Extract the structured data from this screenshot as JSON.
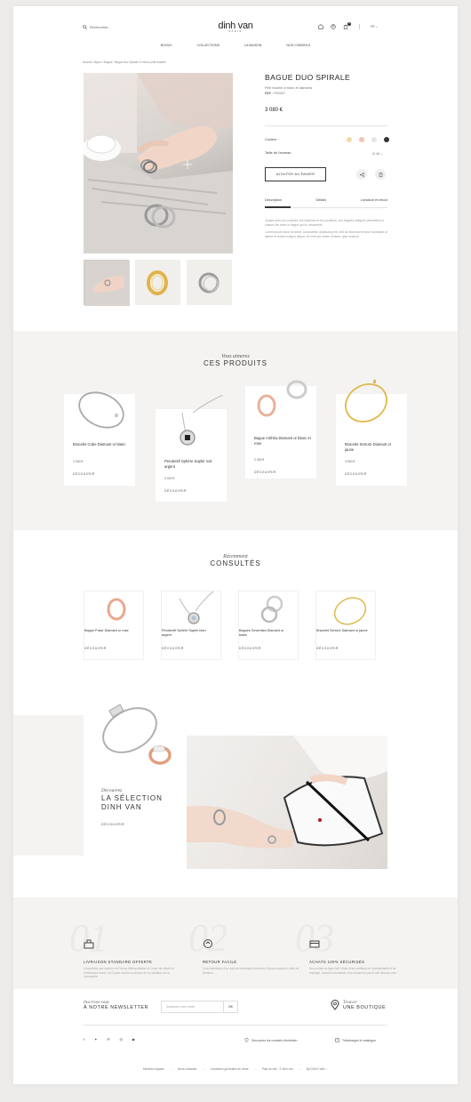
{
  "header": {
    "search_placeholder": "Rechercher...",
    "logo": "dinh van",
    "logo_sub": "PARIS",
    "lang": "FR",
    "cart_count": "0",
    "nav": [
      "BIJOUX",
      "COLLECTIONS",
      "LA MAISON",
      "NOS CONSEILS"
    ]
  },
  "breadcrumb": "Accueil  /  Bijoux  /  Bague  /  Bague duo Spirale Or blanc petit modèle",
  "product": {
    "title": "BAGUE DUO SPIRALE",
    "subtitle": "Petit modèle or blanc et diamants",
    "ref_label": "REF :",
    "ref": "R00007",
    "price": "3 080 €",
    "color_label": "Couleur :",
    "colors": [
      "#f3dca3",
      "#f2c6b0",
      "#e5e5e5",
      "#333333"
    ],
    "size_label": "Taille de l'anneau :",
    "size_value": "Ø 48",
    "add_to_cart": "AJOUTER AU PANIER",
    "tabs": [
      "Description",
      "Détails",
      "Livraison et retour"
    ],
    "desc_1": "Jouant avec les couleurs, les matières et les positions, ces bagues ludiques permettent à chacun de créer la bague qui lui ressemble.",
    "desc_2": "Lorem ipsum dolor sit amet, consectetur adipiscing elit, sed do eiusmod tempor incididunt ut labore et dolore magna aliqua. Ut enim ad minim veniam, quis nostrud."
  },
  "related": {
    "kicker": "Vous aimerez",
    "title": "CES PRODUITS",
    "items": [
      {
        "name": "Bracelet Cube Diamant or blanc",
        "price": "2 000 €",
        "link": "DÉCOUVRIR"
      },
      {
        "name": "Pendentif Sphère Saphir noir argent",
        "price": "3 000 €",
        "link": "DÉCOUVRIR"
      },
      {
        "name": "Bague Anthéa Diamant or blanc et rose",
        "price": "2 300 €",
        "link": "DÉCOUVRIR"
      },
      {
        "name": "Bracelet Serrure Diamant or jaune",
        "price": "3 500 €",
        "link": "DÉCOUVRIR"
      }
    ]
  },
  "recent": {
    "kicker": "Récemment",
    "title": "CONSULTÉS",
    "items": [
      {
        "name": "Bague Pulse Diamant or rose",
        "link": "DÉCOUVRIR"
      },
      {
        "name": "Pendentif Sphère Saphir bleu argent",
        "link": "DÉCOUVRIR"
      },
      {
        "name": "Bagues Seventies Diamant or blanc",
        "link": "DÉCOUVRIR"
      },
      {
        "name": "Bracelet Serrure Diamant or jaune",
        "link": "DÉCOUVRIR"
      }
    ]
  },
  "discover": {
    "kicker": "Découvrez",
    "title_1": "LA SÉLECTION",
    "title_2": "DINH VAN",
    "link": "DÉCOUVRIR"
  },
  "reassurance": [
    {
      "num": "01",
      "title": "LIVRAISON STANDARD OFFERTE",
      "text": "L'expédition par courrier en France Métropolitaine et Corse est offerte et s'effectuera entre 1 et 2 jours ouvrés à compter de la validation de la commande."
    },
    {
      "num": "02",
      "title": "RETOUR FACILE",
      "text": "Vous bénéficiez d'un droit de rétractation dans les 14 jours suivant la date de livraison."
    },
    {
      "num": "03",
      "title": "ACHATS 100% SÉCURISÉS",
      "text": "Nos achats en ligne font l'objet d'une politique de confidentialité et de cryptage. Aucune information n'est conservée par le site dinhvan.com"
    }
  ],
  "newsletter": {
    "kicker": "Inscrivez-vous",
    "title": "À NOTRE NEWSLETTER",
    "placeholder": "Saisissez votre email",
    "ok": "OK"
  },
  "store": {
    "kicker": "Trouver",
    "title": "UNE BOUTIQUE"
  },
  "footer": {
    "advice": "Découvrez les conseils d'entretien",
    "catalog": "Téléchargez le catalogue",
    "links": [
      "Mentions légales",
      "Nous contacter",
      "Conditions générales de vente",
      "Plan du site - © dinh van",
      "By DOKO with"
    ]
  }
}
